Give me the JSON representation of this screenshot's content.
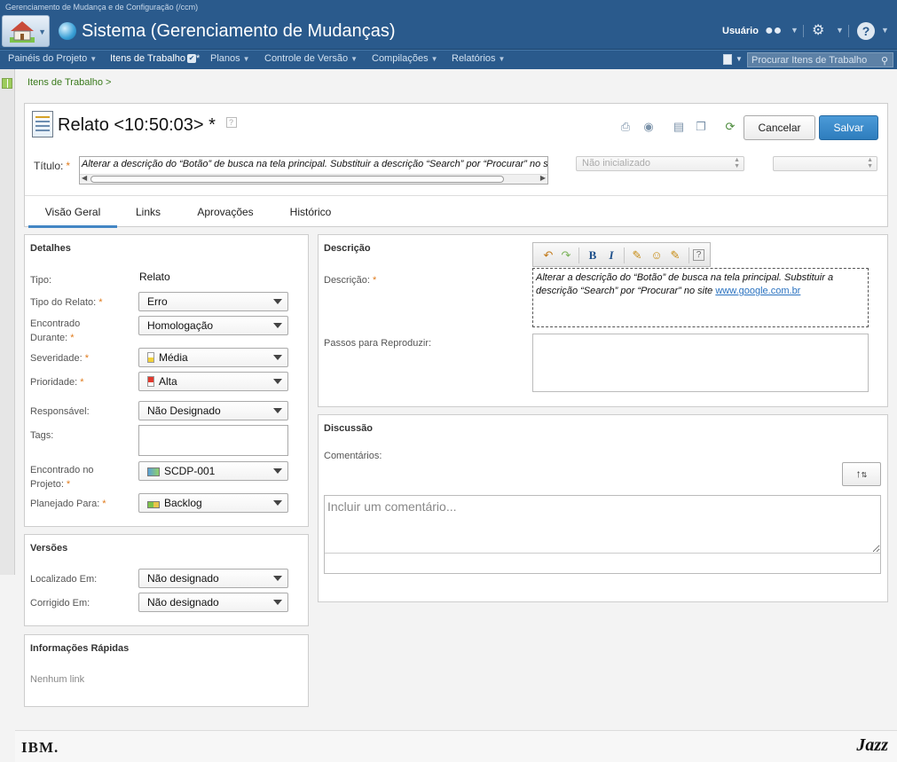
{
  "app": {
    "caption": "Gerenciamento de Mudança e de Configuração (/ccm)",
    "system_title": "Sistema (Gerenciamento de Mudanças)",
    "user_label": "Usuário"
  },
  "nav": {
    "items": [
      {
        "label": "Painéis do Projeto"
      },
      {
        "label": "Itens de Trabalho"
      },
      {
        "label": "Planos"
      },
      {
        "label": "Controle de Versão"
      },
      {
        "label": "Compilações"
      },
      {
        "label": "Relatórios"
      }
    ],
    "work_items_marker": "*",
    "search_placeholder": "Procurar Itens de Trabalho"
  },
  "breadcrumb": "Itens de Trabalho >",
  "header": {
    "title": "Relato <10:50:03>",
    "dirty_marker": "*",
    "help": "?",
    "cancel_label": "Cancelar",
    "save_label": "Salvar",
    "title_label": "Título:",
    "title_value": "Alterar a descrição do “Botão” de busca na tela principal. Substituir a descrição “Search” por “Procurar” no site www.google.com.br",
    "state_value": "Não inicializado",
    "resolution_value": "",
    "tabs": [
      {
        "label": "Visão Geral",
        "active": true
      },
      {
        "label": "Links",
        "active": false
      },
      {
        "label": "Aprovações",
        "active": false
      },
      {
        "label": "Histórico",
        "active": false
      }
    ]
  },
  "details": {
    "title": "Detalhes",
    "type_label": "Tipo:",
    "type_value": "Relato",
    "relato_type_label": "Tipo do Relato:",
    "relato_type_value": "Erro",
    "found_during_label_1": "Encontrado",
    "found_during_label_2": "Durante:",
    "found_during_value": "Homologação",
    "severity_label": "Severidade:",
    "severity_value": "Média",
    "priority_label": "Prioridade:",
    "priority_value": "Alta",
    "owner_label": "Responsável:",
    "owner_value": "Não Designado",
    "tags_label": "Tags:",
    "found_in_label_1": "Encontrado no",
    "found_in_label_2": "Projeto:",
    "found_in_value": "SCDP-001",
    "planned_for_label": "Planejado Para:",
    "planned_for_value": "Backlog"
  },
  "versions": {
    "title": "Versões",
    "found_in_label": "Localizado Em:",
    "found_in_value": "Não designado",
    "fixed_in_label": "Corrigido Em:",
    "fixed_in_value": "Não designado"
  },
  "quick_info": {
    "title": "Informações Rápidas",
    "empty_text": "Nenhum link"
  },
  "description": {
    "title": "Descrição",
    "label": "Descrição:",
    "text_before_link": "Alterar a descrição do “Botão” de busca na tela principal. Substituir a descrição “Search” por “Procurar” no site ",
    "link_text": "www.google.com.br",
    "steps_label": "Passos para Reproduzir:",
    "toolbar": {
      "bold": "B",
      "italic": "I",
      "help": "?"
    }
  },
  "discussion": {
    "title": "Discussão",
    "comments_label": "Comentários:",
    "sort_label": "↑",
    "comment_placeholder": "Incluir um comentário..."
  },
  "footer": {
    "ibm": "IBM.",
    "jazz": "Jazz"
  },
  "colors": {
    "banner": "#2a5a8c",
    "accent": "#4386c4",
    "required": "#e07b1c",
    "save_button": "#2e7dbd"
  }
}
